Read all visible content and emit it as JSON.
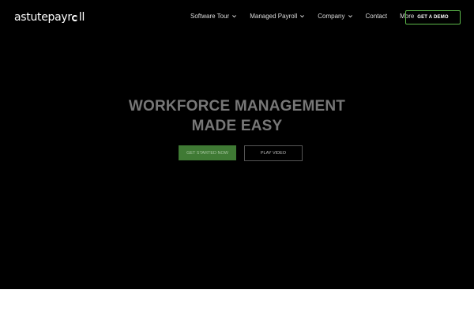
{
  "brand": {
    "logo_part1": "astutepayr",
    "logo_part2": "ll"
  },
  "nav": {
    "items": [
      {
        "label": "Software Tour",
        "has_dropdown": true
      },
      {
        "label": "Managed Payroll",
        "has_dropdown": true
      },
      {
        "label": "Company",
        "has_dropdown": true
      },
      {
        "label": "Contact",
        "has_dropdown": false
      },
      {
        "label": "More",
        "has_dropdown": false
      }
    ],
    "demo_button": "GET A DEMO"
  },
  "hero": {
    "headline_line1": "WORKFORCE MANAGEMENT",
    "headline_line2": "MADE EASY",
    "primary_cta": "GET STARTED NOW",
    "secondary_cta": "PLAY VIDEO"
  },
  "colors": {
    "hero_background": "#000000",
    "accent_green": "#3f7a34",
    "demo_border": "#5cb84a",
    "page_background": "#ffffff"
  }
}
